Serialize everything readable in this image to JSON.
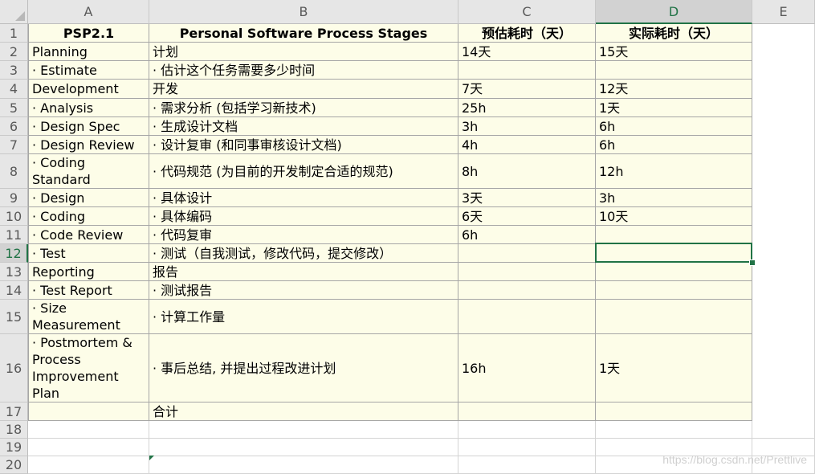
{
  "columns": [
    "A",
    "B",
    "C",
    "D",
    "E"
  ],
  "rows": [
    "1",
    "2",
    "3",
    "4",
    "5",
    "6",
    "7",
    "8",
    "9",
    "10",
    "11",
    "12",
    "13",
    "14",
    "15",
    "16",
    "17",
    "18",
    "19",
    "20"
  ],
  "selected_column": "D",
  "selected_row": "12",
  "table": {
    "headers": [
      "PSP2.1",
      "Personal Software Process Stages",
      "预估耗时（天）",
      "实际耗时（天）"
    ],
    "rows": [
      [
        "Planning",
        "计划",
        "14天",
        "15天"
      ],
      [
        "· Estimate",
        "· 估计这个任务需要多少时间",
        "",
        ""
      ],
      [
        "Development",
        "开发",
        "7天",
        "12天"
      ],
      [
        "· Analysis",
        "· 需求分析 (包括学习新技术)",
        "25h",
        "1天"
      ],
      [
        "· Design Spec",
        "· 生成设计文档",
        "3h",
        "6h"
      ],
      [
        "· Design Review",
        "· 设计复审 (和同事审核设计文档)",
        "4h",
        "6h"
      ],
      [
        "· Coding Standard",
        "· 代码规范 (为目前的开发制定合适的规范)",
        "8h",
        "12h"
      ],
      [
        "· Design",
        "· 具体设计",
        "3天",
        "3h"
      ],
      [
        "· Coding",
        "· 具体编码",
        "6天",
        "10天"
      ],
      [
        "· Code Review",
        "· 代码复审",
        "6h",
        ""
      ],
      [
        "· Test",
        "· 测试（自我测试，修改代码，提交修改）",
        "",
        ""
      ],
      [
        "Reporting",
        "报告",
        "",
        ""
      ],
      [
        "· Test Report",
        "· 测试报告",
        "",
        ""
      ],
      [
        "· Size Measurement",
        "· 计算工作量",
        "",
        ""
      ],
      [
        "· Postmortem & Process Improvement Plan",
        "· 事后总结, 并提出过程改进计划",
        "16h",
        "1天"
      ],
      [
        "",
        "合计",
        "",
        ""
      ]
    ]
  },
  "watermark": "https://blog.csdn.net/Prettlive"
}
